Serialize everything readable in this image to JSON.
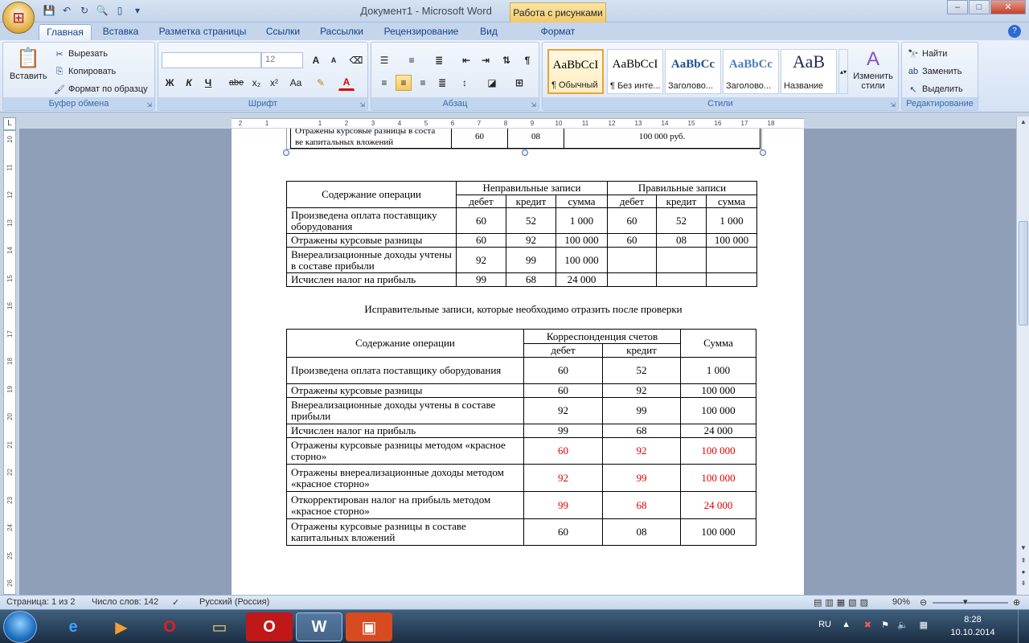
{
  "window": {
    "title": "Документ1 - Microsoft Word",
    "context_tab": "Работа с рисунками",
    "minimize": "–",
    "maximize": "□",
    "close": "✕"
  },
  "tabs": [
    "Главная",
    "Вставка",
    "Разметка страницы",
    "Ссылки",
    "Рассылки",
    "Рецензирование",
    "Вид",
    "Формат"
  ],
  "clipboard": {
    "paste": "Вставить",
    "cut": "Вырезать",
    "copy": "Копировать",
    "format_painter": "Формат по образцу",
    "label": "Буфер обмена"
  },
  "font": {
    "name": "",
    "size": "12",
    "label": "Шрифт",
    "bold": "Ж",
    "italic": "К",
    "underline": "Ч",
    "strike": "abe",
    "subscript": "x₂",
    "superscript": "x²",
    "case": "Aa",
    "grow": "A",
    "shrink": "A"
  },
  "paragraph": {
    "label": "Абзац"
  },
  "styles": {
    "label": "Стили",
    "items": [
      {
        "sample": "AaBbCcI",
        "name": "¶ Обычный"
      },
      {
        "sample": "AaBbCcI",
        "name": "¶ Без инте..."
      },
      {
        "sample": "AaBbCc",
        "name": "Заголово..."
      },
      {
        "sample": "AaBbCc",
        "name": "Заголово..."
      },
      {
        "sample": "АаВ",
        "name": "Название"
      }
    ],
    "change": "Изменить стили"
  },
  "editing": {
    "label": "Редактирование",
    "find": "Найти",
    "replace": "Заменить",
    "select": "Выделить"
  },
  "ruler": {
    "h_ticks": [
      "2",
      "1",
      "",
      "1",
      "2",
      "3",
      "4",
      "5",
      "6",
      "7",
      "8",
      "9",
      "10",
      "11",
      "12",
      "13",
      "14",
      "15",
      "16",
      "17",
      "18"
    ],
    "v_ticks": [
      "10",
      "11",
      "12",
      "13",
      "14",
      "15",
      "16",
      "17",
      "18",
      "19",
      "20",
      "21",
      "22",
      "23",
      "24",
      "25",
      "26"
    ]
  },
  "document": {
    "top_fragment": {
      "text1": "Отражены курсовые разницы в соста",
      "text2": "ве капитальных вложений",
      "c1": "60",
      "c2": "08",
      "c3": "100 000 руб."
    },
    "table1": {
      "h_content": "Содержание операции",
      "h_wrong": "Неправильные записи",
      "h_right": "Правильные записи",
      "sub": [
        "дебет",
        "кредит",
        "сумма",
        "дебет",
        "кредит",
        "сумма"
      ],
      "rows": [
        {
          "text": "Произведена оплата поставщику оборудования",
          "cells": [
            "60",
            "52",
            "1 000",
            "60",
            "52",
            "1 000"
          ]
        },
        {
          "text": "Отражены курсовые разницы",
          "cells": [
            "60",
            "92",
            "100 000",
            "60",
            "08",
            "100 000"
          ]
        },
        {
          "text": "Внереализационные доходы учтены в составе прибыли",
          "cells": [
            "92",
            "99",
            "100 000",
            "",
            "",
            ""
          ]
        },
        {
          "text": "Исчислен налог на прибыль",
          "cells": [
            "99",
            "68",
            "24 000",
            "",
            "",
            ""
          ]
        }
      ]
    },
    "caption": "Исправительные записи, которые необходимо отразить после проверки",
    "table2": {
      "h_content": "Содержание операции",
      "h_corr": "Корреспонденция счетов",
      "h_debit": "дебет",
      "h_credit": "кредит",
      "h_sum": "Сумма",
      "rows": [
        {
          "text": "Произведена оплата поставщику оборудования",
          "debit": "60",
          "credit": "52",
          "sum": "1 000",
          "red": false
        },
        {
          "text": "Отражены курсовые разницы",
          "debit": "60",
          "credit": "92",
          "sum": "100 000",
          "red": false
        },
        {
          "text": "Внереализационные доходы учтены в составе прибыли",
          "debit": "92",
          "credit": "99",
          "sum": "100 000",
          "red": false
        },
        {
          "text": "Исчислен налог на прибыль",
          "debit": "99",
          "credit": "68",
          "sum": "24 000",
          "red": false
        },
        {
          "text": "Отражены курсовые разницы методом «красное сторно»",
          "debit": "60",
          "credit": "92",
          "sum": "100 000",
          "red": true
        },
        {
          "text": "Отражены внереализационные доходы методом «красное сторно»",
          "debit": "92",
          "credit": "99",
          "sum": "100 000",
          "red": true
        },
        {
          "text": "Откорректирован налог на прибыль методом «красное сторно»",
          "debit": "99",
          "credit": "68",
          "sum": "24 000",
          "red": true
        },
        {
          "text": "Отражены курсовые разницы в составе капитальных вложений",
          "debit": "60",
          "credit": "08",
          "sum": "100 000",
          "red": false
        }
      ]
    }
  },
  "status": {
    "page": "Страница: 1 из 2",
    "words": "Число слов: 142",
    "language": "Русский (Россия)",
    "zoom": "90%"
  },
  "taskbar": {
    "lang": "RU",
    "time": "8:28",
    "date": "10.10.2014"
  },
  "colors": {
    "red_storno": "#e00000",
    "accent": "#2b579a"
  }
}
